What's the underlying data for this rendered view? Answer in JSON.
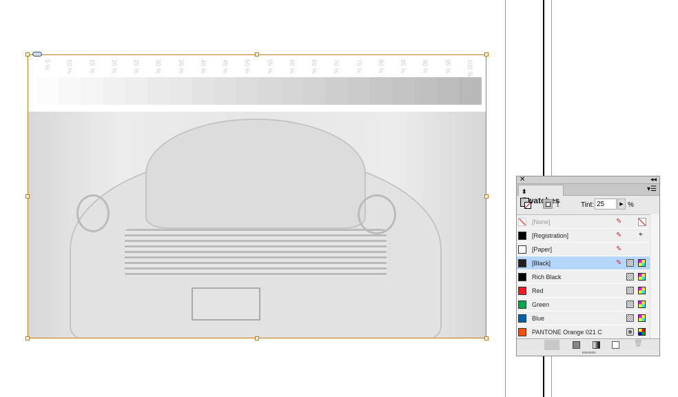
{
  "scale": {
    "labels": [
      "5 %",
      "10 %",
      "15 %",
      "20 %",
      "25 %",
      "30 %",
      "35 %",
      "40 %",
      "45 %",
      "50 %",
      "55 %",
      "60 %",
      "65 %",
      "70 %",
      "75 %",
      "80 %",
      "85 %",
      "90 %",
      "95 %",
      "100 %"
    ],
    "tints_percent": [
      5,
      10,
      15,
      20,
      25,
      30,
      35,
      40,
      45,
      50,
      55,
      60,
      65,
      70,
      75,
      80,
      85,
      90,
      95,
      100
    ]
  },
  "panel": {
    "title": "Swatches",
    "tint_label": "Tint:",
    "tint_value": "25",
    "percent": "%",
    "swatches": [
      {
        "name": "[None]",
        "color": "none"
      },
      {
        "name": "[Registration]",
        "color": "#000000"
      },
      {
        "name": "[Paper]",
        "color": "#ffffff"
      },
      {
        "name": "[Black]",
        "color": "#231f20",
        "selected": true
      },
      {
        "name": "Rich Black",
        "color": "#000000"
      },
      {
        "name": "Red",
        "color": "#ed1c24"
      },
      {
        "name": "Green",
        "color": "#00a651"
      },
      {
        "name": "Blue",
        "color": "#0060a8"
      },
      {
        "name": "PANTONE Orange 021 C",
        "color": "#fe5000"
      }
    ]
  },
  "colors": {
    "frame": "#c07a10",
    "selection": "#b5d5fb"
  }
}
